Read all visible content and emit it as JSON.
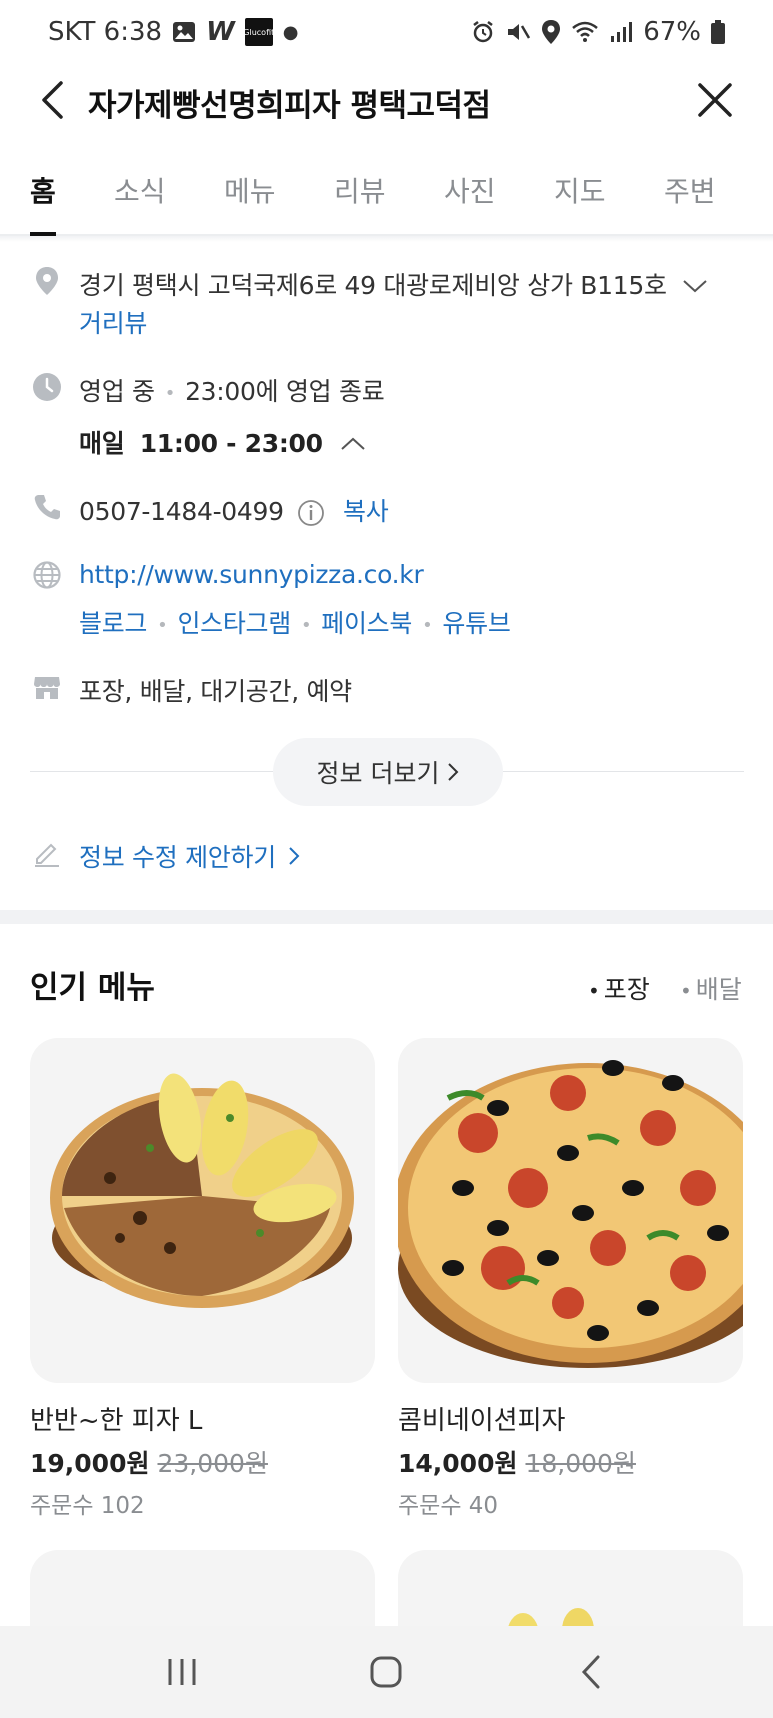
{
  "status_bar": {
    "carrier_time": "SKT 6:38",
    "w_app": "W",
    "gluco_label": "Glucofit",
    "battery": "67%"
  },
  "header": {
    "title": "자가제빵선명희피자 평택고덕점"
  },
  "tabs": [
    "홈",
    "소식",
    "메뉴",
    "리뷰",
    "사진",
    "지도",
    "주변"
  ],
  "info": {
    "address": "경기 평택시 고덕국제6로 49 대광로제비앙 상가 B115호",
    "street_view": "거리뷰",
    "status": "영업 중",
    "close_time": "23:00에 영업 종료",
    "hours_day": "매일",
    "hours_range": "11:00 - 23:00",
    "phone": "0507-1484-0499",
    "copy": "복사",
    "website": "http://www.sunnypizza.co.kr",
    "sns": [
      "블로그",
      "인스타그램",
      "페이스북",
      "유튜브"
    ],
    "services": "포장, 배달, 대기공간, 예약",
    "more_info": "정보 더보기",
    "suggest_edit": "정보 수정 제안하기"
  },
  "popular": {
    "title": "인기 메뉴",
    "filters": [
      "포장",
      "배달"
    ],
    "items": [
      {
        "name": "반반~한 피자 L",
        "price": "19,000원",
        "original_price": "23,000원",
        "orders": "주문수 102"
      },
      {
        "name": "콤비네이션피자",
        "price": "14,000원",
        "original_price": "18,000원",
        "orders": "주문수 40"
      }
    ]
  }
}
